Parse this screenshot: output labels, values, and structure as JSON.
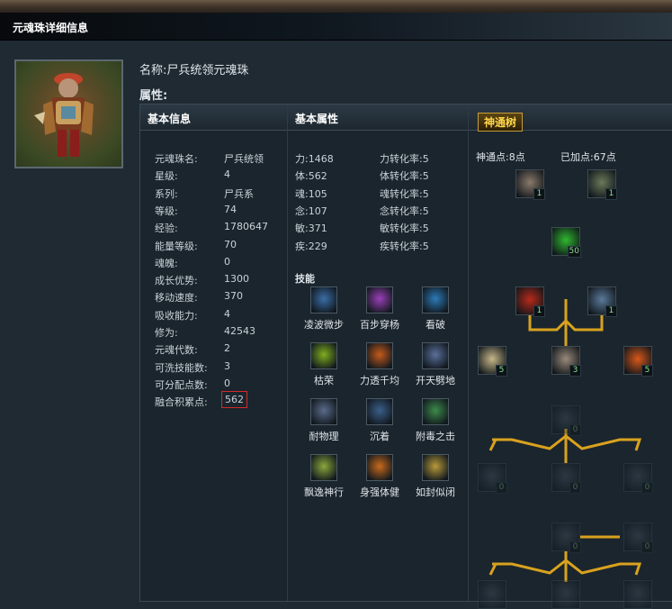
{
  "window": {
    "title": "元魂珠详细信息"
  },
  "header": {
    "name_label": "名称:",
    "name_value": "尸兵统领元魂珠",
    "attr_label": "属性:"
  },
  "tabs": {
    "basic_info": "基本信息",
    "basic_attr": "基本属性",
    "tree": "神通树"
  },
  "basic_info": [
    {
      "k": "元魂珠名:",
      "v": "尸兵统领"
    },
    {
      "k": "星级:",
      "v": "4"
    },
    {
      "k": "系列:",
      "v": "尸兵系"
    },
    {
      "k": "等级:",
      "v": "74"
    },
    {
      "k": "经验:",
      "v": "1780647"
    },
    {
      "k": "能量等级:",
      "v": "70"
    },
    {
      "k": "魂魄:",
      "v": "0"
    },
    {
      "k": "成长优势:",
      "v": "1300"
    },
    {
      "k": "移动速度:",
      "v": "370"
    },
    {
      "k": "吸收能力:",
      "v": "4"
    },
    {
      "k": "修为:",
      "v": "42543"
    },
    {
      "k": "元魂代数:",
      "v": "2"
    },
    {
      "k": "可洗技能数:",
      "v": "3"
    },
    {
      "k": "可分配点数:",
      "v": "0"
    },
    {
      "k": "融合积累点:",
      "v": "562"
    }
  ],
  "stats": [
    {
      "a": "力:1468",
      "b": "力转化率:5"
    },
    {
      "a": "体:562",
      "b": "体转化率:5"
    },
    {
      "a": "魂:105",
      "b": "魂转化率:5"
    },
    {
      "a": "念:107",
      "b": "念转化率:5"
    },
    {
      "a": "敏:371",
      "b": "敏转化率:5"
    },
    {
      "a": "疾:229",
      "b": "疾转化率:5"
    }
  ],
  "skills_title": "技能",
  "skills": [
    {
      "name": "凌波微步",
      "icon": "ice-step-icon",
      "color": "#3a6ea8"
    },
    {
      "name": "百步穿杨",
      "icon": "arrow-pierce-icon",
      "color": "#9b3fb8"
    },
    {
      "name": "看破",
      "icon": "insight-icon",
      "color": "#2d7ab8"
    },
    {
      "name": "枯荣",
      "icon": "wither-bloom-icon",
      "color": "#7fae1e"
    },
    {
      "name": "力透千均",
      "icon": "power-strike-icon",
      "color": "#c55a1a"
    },
    {
      "name": "开天劈地",
      "icon": "sky-cleave-icon",
      "color": "#5a6f9a"
    },
    {
      "name": "耐物理",
      "icon": "physical-resist-icon",
      "color": "#5a6b8a"
    },
    {
      "name": "沉着",
      "icon": "composure-icon",
      "color": "#3b5f8a"
    },
    {
      "name": "附毒之击",
      "icon": "poison-strike-icon",
      "color": "#3d8a4a"
    },
    {
      "name": "飘逸神行",
      "icon": "swift-shield-icon",
      "color": "#8aa83a"
    },
    {
      "name": "身强体健",
      "icon": "vigor-shield-icon",
      "color": "#c86a1a"
    },
    {
      "name": "如封似闭",
      "icon": "seal-shield-icon",
      "color": "#b89a3a"
    }
  ],
  "tree": {
    "points_label": "神通点:8点",
    "added_label": "已加点:67点",
    "nodes": [
      {
        "id": "n1",
        "icon": "zombie-head-icon",
        "count": "1",
        "color": "#8a7a6a",
        "active": true
      },
      {
        "id": "n2",
        "icon": "zombie-warrior-icon",
        "count": "1",
        "color": "#6a7a5a",
        "active": true
      },
      {
        "id": "n3",
        "icon": "green-burst-icon",
        "count": "50",
        "color": "#2fb82f",
        "active": true
      },
      {
        "id": "n4",
        "icon": "red-swirl-icon",
        "count": "1",
        "color": "#b82a1a",
        "active": true
      },
      {
        "id": "n5",
        "icon": "lightning-icon",
        "count": "1",
        "color": "#5a7a9a",
        "active": true
      },
      {
        "id": "n6",
        "icon": "skull-icon",
        "count": "5",
        "color": "#c8b88a",
        "active": true
      },
      {
        "id": "n7",
        "icon": "fist-icon",
        "count": "3",
        "color": "#9a8a7a",
        "active": true
      },
      {
        "id": "n8",
        "icon": "flame-arm-icon",
        "count": "5",
        "color": "#d8581a",
        "active": true
      },
      {
        "id": "n9",
        "icon": "locked-node-icon",
        "count": "0",
        "color": "#4a5a6a",
        "active": false
      },
      {
        "id": "n10",
        "icon": "locked-node-icon",
        "count": "0",
        "color": "#4a5a6a",
        "active": false
      },
      {
        "id": "n11",
        "icon": "locked-node-icon",
        "count": "0",
        "color": "#4a5a6a",
        "active": false
      },
      {
        "id": "n12",
        "icon": "locked-node-icon",
        "count": "0",
        "color": "#4a5a6a",
        "active": false
      },
      {
        "id": "n13",
        "icon": "locked-node-icon",
        "count": "0",
        "color": "#4a5a6a",
        "active": false
      },
      {
        "id": "n14",
        "icon": "locked-node-icon",
        "count": "0",
        "color": "#4a5a6a",
        "active": false
      },
      {
        "id": "n15",
        "icon": "locked-node-icon",
        "count": "",
        "color": "#4a5a6a",
        "active": false
      },
      {
        "id": "n16",
        "icon": "locked-node-icon",
        "count": "",
        "color": "#4a5a6a",
        "active": false
      },
      {
        "id": "n17",
        "icon": "locked-node-icon",
        "count": "",
        "color": "#4a5a6a",
        "active": false
      }
    ]
  },
  "highlight_color": "#d42a2a",
  "accent_gold": "#d9a21e"
}
